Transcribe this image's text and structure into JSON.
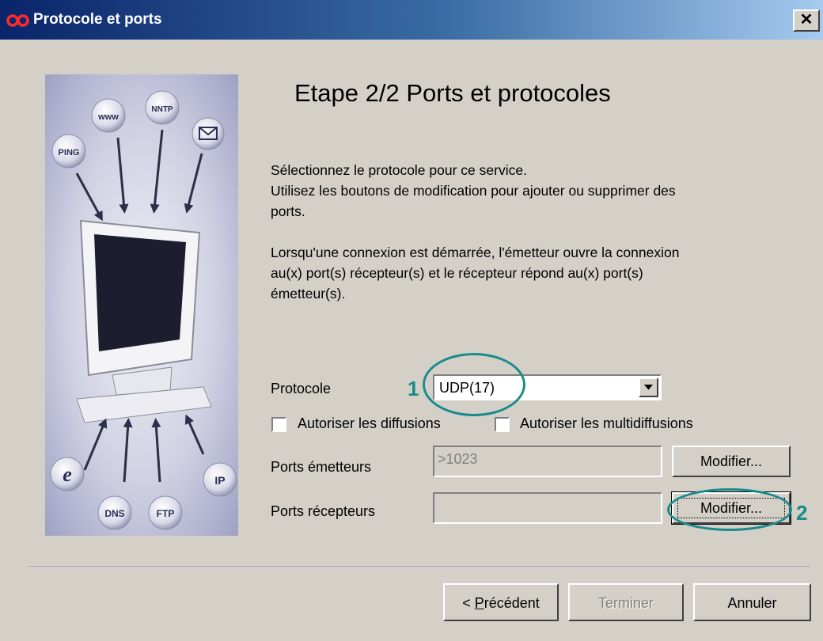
{
  "window": {
    "title": "Protocole et ports",
    "close_glyph": "✕"
  },
  "side_image": {
    "labels": {
      "www": "www",
      "nntp": "NNTP",
      "ping": "PING",
      "dns": "DNS",
      "ftp": "FTP",
      "ip": "IP",
      "ie": "e"
    }
  },
  "wizard": {
    "heading": "Etape 2/2 Ports et protocoles",
    "para1": [
      "Sélectionnez le protocole pour ce service.",
      "Utilisez les boutons de modification pour ajouter ou supprimer des",
      "ports."
    ],
    "para2": [
      "Lorsqu'une connexion est démarrée, l'émetteur ouvre la connexion",
      "au(x) port(s) récepteur(s) et le récepteur répond au(x) port(s)",
      "émetteur(s)."
    ]
  },
  "form": {
    "protocol_label": "Protocole",
    "protocol_value": "UDP(17)",
    "broadcast_label": "Autoriser les diffusions",
    "broadcast_checked": false,
    "multicast_label": "Autoriser les multidiffusions",
    "multicast_checked": false,
    "sender_ports_label": "Ports émetteurs",
    "sender_ports_value": ">1023",
    "receiver_ports_label": "Ports récepteurs",
    "receiver_ports_value": "",
    "modify_label": "Modifier..."
  },
  "annotations": {
    "one": "1",
    "two": "2",
    "color": "#1a8b8b"
  },
  "footer": {
    "prev_mnemonic": "P",
    "prev_prefix": "< ",
    "prev_rest": "récédent",
    "finish": "Terminer",
    "cancel": "Annuler"
  }
}
